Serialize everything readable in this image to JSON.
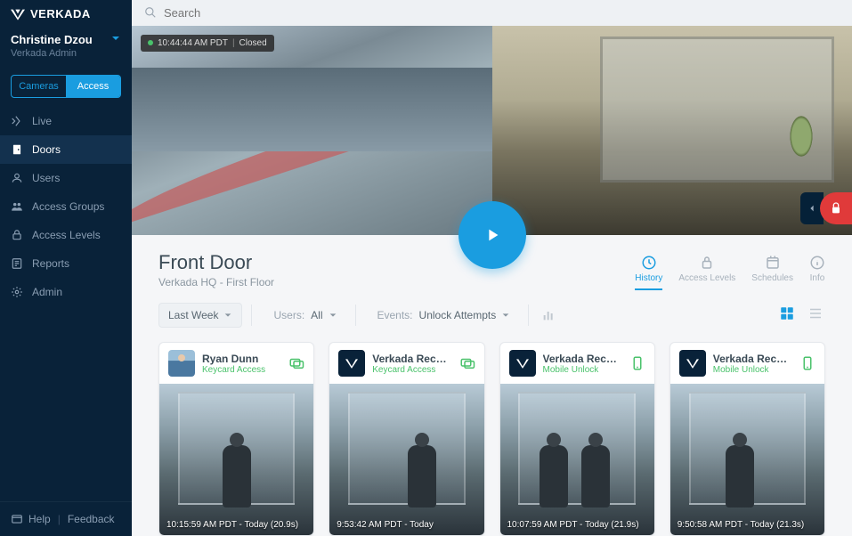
{
  "brand": "VERKADA",
  "user": {
    "name": "Christine Dzou",
    "role": "Verkada Admin"
  },
  "toggle": {
    "left": "Cameras",
    "right": "Access"
  },
  "nav": {
    "live": "Live",
    "doors": "Doors",
    "users": "Users",
    "groups": "Access Groups",
    "levels": "Access Levels",
    "reports": "Reports",
    "admin": "Admin"
  },
  "footer": {
    "help": "Help",
    "feedback": "Feedback"
  },
  "search_placeholder": "Search",
  "video": {
    "timestamp": "10:44:44 AM PDT",
    "state": "Closed"
  },
  "door": {
    "name": "Front Door",
    "location": "Verkada HQ - First Floor"
  },
  "tabs": {
    "history": "History",
    "levels": "Access Levels",
    "schedules": "Schedules",
    "info": "Info"
  },
  "filters": {
    "range": "Last Week",
    "users_label": "Users:",
    "users_value": "All",
    "events_label": "Events:",
    "events_value": "Unlock Attempts"
  },
  "events": [
    {
      "name": "Ryan Dunn",
      "method": "Keycard Access",
      "time": "10:15:59 AM PDT - Today (20.9s)",
      "icon": "keycard",
      "avatar": "person"
    },
    {
      "name": "Verkada Reception",
      "method": "Keycard Access",
      "time": "9:53:42 AM PDT - Today",
      "icon": "keycard",
      "avatar": "logo"
    },
    {
      "name": "Verkada Reception",
      "method": "Mobile Unlock",
      "time": "10:07:59 AM PDT - Today (21.9s)",
      "icon": "mobile",
      "avatar": "logo"
    },
    {
      "name": "Verkada Reception",
      "method": "Mobile Unlock",
      "time": "9:50:58 AM PDT - Today (21.3s)",
      "icon": "mobile",
      "avatar": "logo"
    }
  ]
}
